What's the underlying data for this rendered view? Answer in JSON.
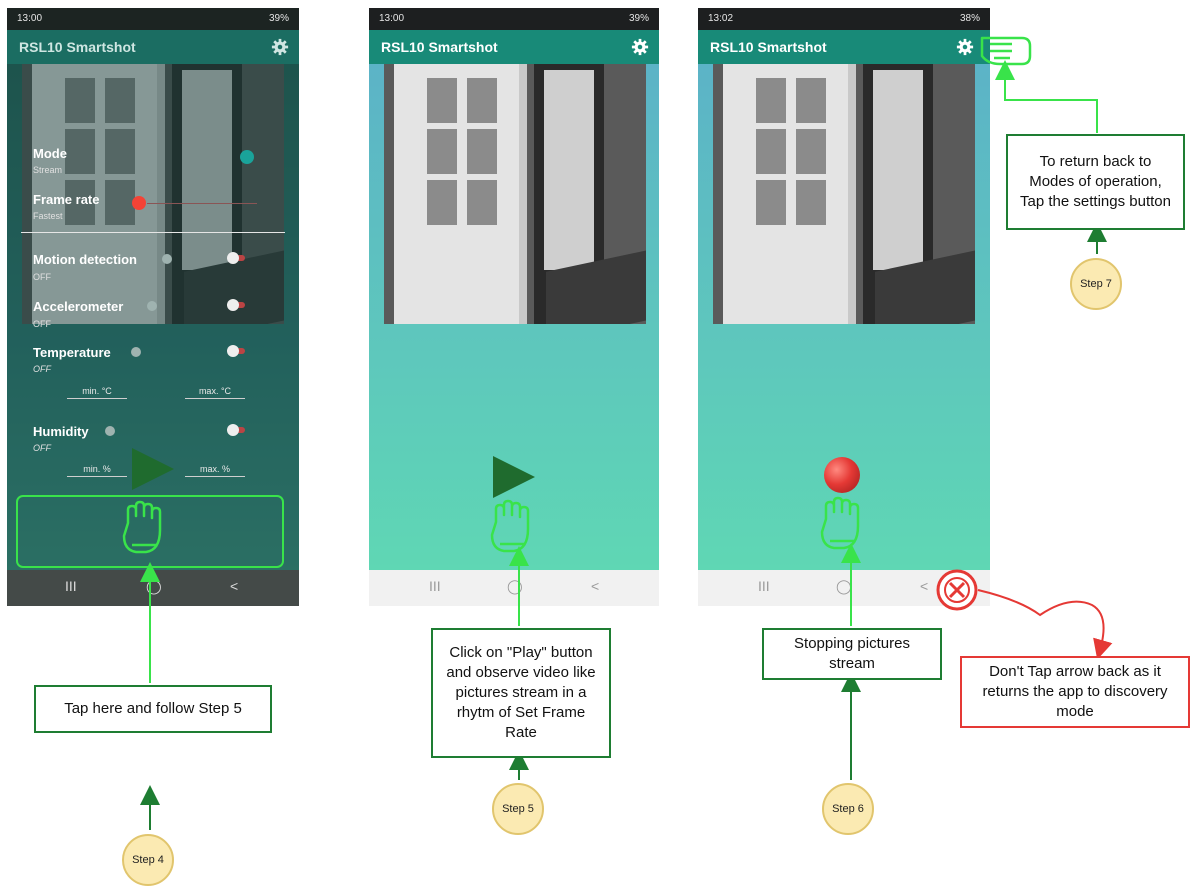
{
  "screens": [
    {
      "status_time": "13:00",
      "status_right": "39%",
      "app_title": "RSL10 Smartshot"
    },
    {
      "status_time": "13:00",
      "status_right": "39%",
      "app_title": "RSL10 Smartshot"
    },
    {
      "status_time": "13:02",
      "status_right": "38%",
      "app_title": "RSL10 Smartshot"
    }
  ],
  "settings": {
    "mode_label": "Mode",
    "mode_value": "Stream",
    "frame_label": "Frame rate",
    "frame_value": "Fastest",
    "motion_label": "Motion detection",
    "motion_value": "OFF",
    "accel_label": "Accelerometer",
    "accel_value": "OFF",
    "temp_label": "Temperature",
    "temp_value": "OFF",
    "temp_min": "min. °C",
    "temp_max": "max. °C",
    "hum_label": "Humidity",
    "hum_value": "OFF",
    "hum_min": "min. %",
    "hum_max": "max. %"
  },
  "nav": {
    "recents": "III",
    "home": "◯",
    "back": "<"
  },
  "callouts": {
    "step4_text": "Tap here and follow Step 5",
    "step5_text": "Click on \"Play\" button and observe video like pictures stream in a rhytm of Set Frame Rate",
    "step6_text": "Stopping pictures stream",
    "step7_text": "To return back to Modes of operation, Tap the settings button",
    "warning_text": "Don't Tap arrow back as it returns the app to discovery mode"
  },
  "steps": {
    "s4": "Step 4",
    "s5": "Step 5",
    "s6": "Step 6",
    "s7": "Step 7"
  },
  "colors": {
    "appbar": "#188a78",
    "callout_border": "#1e7d32",
    "highlight": "#39e34a",
    "warning": "#e53935",
    "step_fill": "#fbeab2"
  }
}
